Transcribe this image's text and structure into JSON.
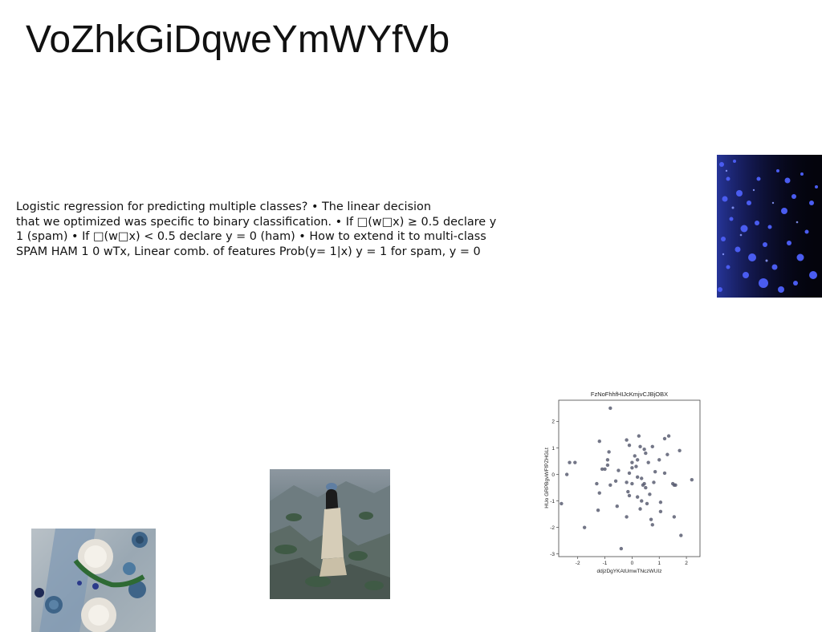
{
  "slide": {
    "title": "VoZhkGiDqweYmWYfVb",
    "body_lines": [
      "Logistic regression for predicting multiple classes? • The linear decision",
      "that we optimized was specific to binary classification. • If □(w□x) ≥ 0.5 declare y",
      "1 (spam) • If □(w□x) < 0.5 declare y = 0 (ham) • How to extend it to multi-class",
      "SPAM HAM 1 0 wTx, Linear comb. of features Prob(y= 1|x) y = 1 for spam, y = 0"
    ]
  },
  "images": {
    "blue_particles": "photo",
    "woman_rocks": "photo",
    "table_setting": "photo"
  },
  "chart_data": {
    "type": "scatter",
    "title": "FzNoFhhfHIJcKmjvCJBjOBX",
    "xlabel": "ddjzDgYKAtUmwTNczWUIz",
    "ylabel": "HUo GRPBgvWFfPZHGLt",
    "xlim": [
      -2.7,
      2.5
    ],
    "ylim": [
      -3.1,
      2.8
    ],
    "xticks": [
      "-2",
      "-1",
      "0",
      "1",
      "2"
    ],
    "yticks": [
      "2",
      "1",
      "0",
      "-1",
      "-2",
      "-3"
    ],
    "grid": false,
    "point_color": "#5a5e72",
    "points": [
      [
        -0.8,
        2.5
      ],
      [
        -2.6,
        -1.1
      ],
      [
        -2.3,
        0.45
      ],
      [
        -2.4,
        0.0
      ],
      [
        -2.1,
        0.45
      ],
      [
        -1.2,
        1.25
      ],
      [
        -1.1,
        0.2
      ],
      [
        -0.9,
        0.35
      ],
      [
        -0.85,
        0.85
      ],
      [
        -1.0,
        0.2
      ],
      [
        -0.9,
        0.55
      ],
      [
        -1.2,
        -0.7
      ],
      [
        -1.25,
        -1.35
      ],
      [
        -1.75,
        -2.0
      ],
      [
        -0.8,
        -0.4
      ],
      [
        -0.6,
        -0.25
      ],
      [
        -0.55,
        -1.2
      ],
      [
        -0.5,
        0.15
      ],
      [
        -0.4,
        -2.8
      ],
      [
        -0.2,
        -0.3
      ],
      [
        -0.15,
        -0.65
      ],
      [
        -0.1,
        -0.8
      ],
      [
        -0.2,
        -1.6
      ],
      [
        -0.1,
        0.05
      ],
      [
        0.0,
        0.25
      ],
      [
        0.0,
        0.45
      ],
      [
        0.1,
        0.7
      ],
      [
        0.15,
        0.3
      ],
      [
        0.2,
        0.55
      ],
      [
        0.2,
        -0.1
      ],
      [
        0.2,
        -0.85
      ],
      [
        0.25,
        1.45
      ],
      [
        0.3,
        1.05
      ],
      [
        0.35,
        -0.15
      ],
      [
        0.4,
        -0.4
      ],
      [
        0.45,
        -0.35
      ],
      [
        0.45,
        0.95
      ],
      [
        0.5,
        0.8
      ],
      [
        0.5,
        -0.5
      ],
      [
        0.55,
        -1.1
      ],
      [
        0.6,
        0.45
      ],
      [
        0.65,
        -0.75
      ],
      [
        0.7,
        -1.7
      ],
      [
        0.75,
        -1.9
      ],
      [
        0.75,
        1.05
      ],
      [
        0.8,
        -0.3
      ],
      [
        0.0,
        -0.35
      ],
      [
        -0.2,
        1.3
      ],
      [
        -0.1,
        1.1
      ],
      [
        0.35,
        -1.0
      ],
      [
        0.3,
        -1.3
      ],
      [
        1.0,
        0.55
      ],
      [
        1.05,
        -1.05
      ],
      [
        1.05,
        -1.4
      ],
      [
        1.2,
        1.35
      ],
      [
        1.2,
        0.05
      ],
      [
        1.3,
        0.75
      ],
      [
        1.35,
        1.45
      ],
      [
        1.5,
        -0.35
      ],
      [
        1.55,
        -0.4
      ],
      [
        1.6,
        -0.4
      ],
      [
        1.55,
        -1.6
      ],
      [
        1.75,
        0.9
      ],
      [
        1.8,
        -2.3
      ],
      [
        2.2,
        -0.2
      ],
      [
        -1.3,
        -0.35
      ],
      [
        0.85,
        0.1
      ]
    ]
  }
}
